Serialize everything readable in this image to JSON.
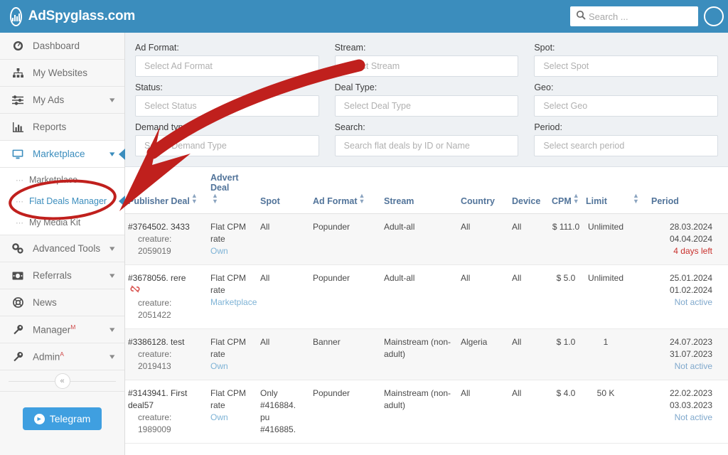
{
  "header": {
    "brand": "AdSpyglass.com",
    "logo_icon": "chart-bars-icon",
    "search_placeholder": "Search ...",
    "search_value": "",
    "search_icon": "search-icon",
    "avatar_icon": "user-avatar-icon"
  },
  "sidebar": {
    "items": [
      {
        "label": "Dashboard",
        "icon": "dashboard-icon",
        "chevron": false,
        "active": false
      },
      {
        "label": "My Websites",
        "icon": "sitemap-icon",
        "chevron": false,
        "active": false
      },
      {
        "label": "My Ads",
        "icon": "sliders-icon",
        "chevron": true,
        "active": false
      },
      {
        "label": "Reports",
        "icon": "bar-chart-icon",
        "chevron": false,
        "active": false
      },
      {
        "label": "Marketplace",
        "icon": "monitor-icon",
        "chevron": true,
        "active": true
      },
      {
        "label": "Advanced Tools",
        "icon": "gears-icon",
        "chevron": true,
        "active": false
      },
      {
        "label": "Referrals",
        "icon": "money-icon",
        "chevron": true,
        "active": false
      },
      {
        "label": "News",
        "icon": "lifebuoy-icon",
        "chevron": false,
        "active": false
      },
      {
        "label": "Manager",
        "icon": "wrench-icon",
        "chevron": true,
        "active": false,
        "sup": "M"
      },
      {
        "label": "Admin",
        "icon": "wrench-icon",
        "chevron": true,
        "active": false,
        "sup": "A"
      }
    ],
    "submenu": [
      {
        "label": "Marketplace",
        "active": false
      },
      {
        "label": "Flat Deals Manager",
        "active": true
      },
      {
        "label": "My Media Kit",
        "active": false
      }
    ],
    "collapse_label": "«",
    "telegram_label": "Telegram",
    "telegram_icon": "telegram-icon"
  },
  "filters": [
    {
      "label": "Ad Format:",
      "placeholder": "Select Ad Format",
      "value": ""
    },
    {
      "label": "Stream:",
      "placeholder": "Select Stream",
      "value": ""
    },
    {
      "label": "Spot:",
      "placeholder": "Select Spot",
      "value": ""
    },
    {
      "label": "Status:",
      "placeholder": "Select Status",
      "value": ""
    },
    {
      "label": "Deal Type:",
      "placeholder": "Select Deal Type",
      "value": ""
    },
    {
      "label": "Geo:",
      "placeholder": "Select Geo",
      "value": ""
    },
    {
      "label": "Demand type:",
      "placeholder": "Select Demand Type",
      "value": ""
    },
    {
      "label": "Search:",
      "placeholder": "Search flat deals by ID or Name",
      "value": ""
    },
    {
      "label": "Period:",
      "placeholder": "Select search period",
      "value": ""
    }
  ],
  "table": {
    "columns": [
      {
        "top": "",
        "label": "Publisher Deal",
        "sortable": true
      },
      {
        "top": "Advert Deal",
        "label": "",
        "sortable": true
      },
      {
        "top": "",
        "label": "Spot",
        "sortable": false
      },
      {
        "top": "",
        "label": "Ad Format",
        "sortable": true
      },
      {
        "top": "",
        "label": "Stream",
        "sortable": false
      },
      {
        "top": "",
        "label": "Country",
        "sortable": false
      },
      {
        "top": "",
        "label": "Device",
        "sortable": false
      },
      {
        "top": "",
        "label": "CPM",
        "sortable": true
      },
      {
        "top": "",
        "label": "Limit",
        "sortable": false
      },
      {
        "top": "",
        "label": "",
        "sortable": true
      },
      {
        "top": "",
        "label": "Period",
        "sortable": false
      }
    ],
    "rows": [
      {
        "publisher_deal_id": "#3764502. 3433",
        "publisher_deal_sub": "creature: 2059019",
        "broken": false,
        "advert_deal": "Flat CPM rate",
        "advert_deal_link": "Own",
        "spot": "All",
        "ad_format": "Popunder",
        "stream": "Adult-all",
        "country": "All",
        "device": "All",
        "cpm": "$ 111.0",
        "limit": "Unlimited",
        "period_start": "28.03.2024",
        "period_end": "04.04.2024",
        "period_status": "4 days left",
        "period_status_type": "days-left"
      },
      {
        "publisher_deal_id": "#3678056. rere",
        "publisher_deal_sub": "creature: 2051422",
        "broken": true,
        "broken_icon": "broken-link-icon",
        "advert_deal": "Flat CPM rate",
        "advert_deal_link": "Marketplace",
        "spot": "All",
        "ad_format": "Popunder",
        "stream": "Adult-all",
        "country": "All",
        "device": "All",
        "cpm": "$ 5.0",
        "limit": "Unlimited",
        "period_start": "25.01.2024",
        "period_end": "01.02.2024",
        "period_status": "Not active",
        "period_status_type": "not-active"
      },
      {
        "publisher_deal_id": "#3386128. test",
        "publisher_deal_sub": "creature: 2019413",
        "broken": false,
        "advert_deal": "Flat CPM rate",
        "advert_deal_link": "Own",
        "spot": "All",
        "ad_format": "Banner",
        "stream": "Mainstream (non-adult)",
        "country": "Algeria",
        "device": "All",
        "cpm": "$ 1.0",
        "limit": "1",
        "period_start": "24.07.2023",
        "period_end": "31.07.2023",
        "period_status": "Not active",
        "period_status_type": "not-active"
      },
      {
        "publisher_deal_id": "#3143941. First deal57",
        "publisher_deal_sub": "creature: 1989009",
        "broken": false,
        "advert_deal": "Flat CPM rate",
        "advert_deal_link": "Own",
        "spot": "Only #416884. pu #416885.",
        "ad_format": "Popunder",
        "stream": "Mainstream (non-adult)",
        "country": "All",
        "device": "All",
        "cpm": "$ 4.0",
        "limit": "50 K",
        "period_start": "22.02.2023",
        "period_end": "03.03.2023",
        "period_status": "Not active",
        "period_status_type": "not-active"
      }
    ]
  },
  "annotation": {
    "arrow_color": "#c0201d",
    "ellipse_color": "#c0201d",
    "target": "Flat Deals Manager"
  },
  "colors": {
    "brand_blue": "#3b8dbd",
    "accent_link": "#7eb3d6",
    "alert_red": "#c9302c",
    "filter_bg": "#eef1f4"
  }
}
